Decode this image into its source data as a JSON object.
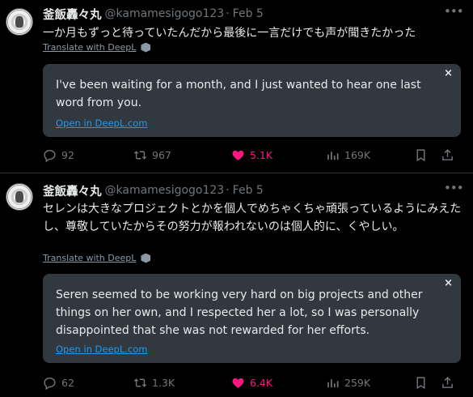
{
  "tweets": [
    {
      "display_name": "釜飯轟々丸",
      "handle": "@kamamesigogo123",
      "separator": "·",
      "date": "Feb 5",
      "text": "一か月もずっと待っていたんだから最後に一言だけでも声が聞きたかった",
      "translate_label": "Translate with DeepL",
      "translation": "I've been waiting for a month, and I just wanted to hear one last word from you.",
      "open_label": "Open in DeepL.com",
      "close": "×",
      "replies": "92",
      "retweets": "967",
      "likes": "5.1K",
      "views": "169K"
    },
    {
      "display_name": "釜飯轟々丸",
      "handle": "@kamamesigogo123",
      "separator": "·",
      "date": "Feb 5",
      "text": "セレンは大きなプロジェクトとかを個人でめちゃくちゃ頑張っているようにみえたし、尊敬していたからその努力が報われないのは個人的に、くやしい。",
      "translate_label": "Translate with DeepL",
      "translation": "Seren seemed to be working very hard on big projects and other things on her own, and I respected her a lot, so I was personally disappointed that she was not rewarded for her efforts.",
      "open_label": "Open in DeepL.com",
      "close": "×",
      "replies": "62",
      "retweets": "1.3K",
      "likes": "6.4K",
      "views": "259K"
    }
  ],
  "colors": {
    "background": "#000000",
    "text": "#e7e9ea",
    "muted": "#71767b",
    "like": "#f91880",
    "link": "#1d9bf0",
    "translation_bg": "#323840"
  },
  "icons": [
    "avatar",
    "more-icon",
    "deepl-icon",
    "close-icon",
    "reply-icon",
    "retweet-icon",
    "heart-icon",
    "views-icon",
    "bookmark-icon",
    "share-icon"
  ]
}
